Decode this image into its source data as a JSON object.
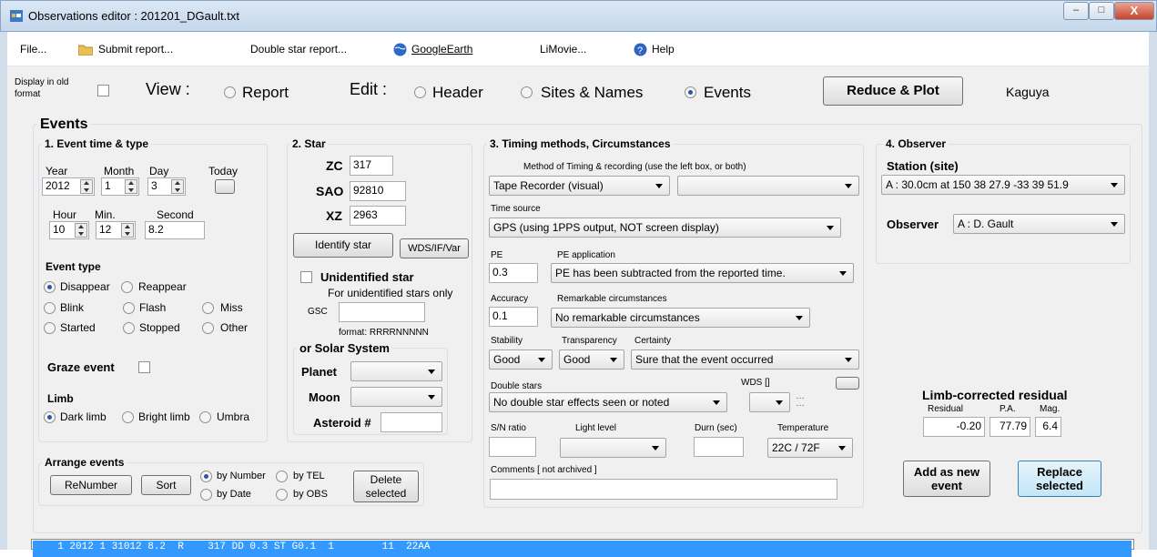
{
  "window": {
    "title": "Observations editor : 201201_DGault.txt",
    "min": "–",
    "max": "□",
    "close": "X"
  },
  "menu": {
    "file": "File...",
    "submit": "Submit report...",
    "double": "Double star report...",
    "googleearth": "GoogleEarth",
    "limovie": "LiMovie...",
    "help": "Help"
  },
  "viewbar": {
    "display_old": "Display in old format",
    "view": "View :",
    "report": "Report",
    "edit": "Edit :",
    "header": "Header",
    "sites": "Sites & Names",
    "events": "Events",
    "reduce": "Reduce & Plot",
    "target": "Kaguya"
  },
  "events_title": "Events",
  "g1": {
    "title": "1. Event time & type",
    "year": "Year",
    "month": "Month",
    "day": "Day",
    "today": "Today",
    "year_val": "2012",
    "month_val": "1",
    "day_val": "3",
    "hour": "Hour",
    "min": "Min.",
    "second": "Second",
    "hour_val": "10",
    "min_val": "12",
    "sec_val": "8.2",
    "event_type": "Event type",
    "disappear": "Disappear",
    "reappear": "Reappear",
    "blink": "Blink",
    "flash": "Flash",
    "miss": "Miss",
    "started": "Started",
    "stopped": "Stopped",
    "other": "Other",
    "graze": "Graze event",
    "limb": "Limb",
    "dark": "Dark limb",
    "bright": "Bright limb",
    "umbra": "Umbra"
  },
  "g2": {
    "title": "2. Star",
    "zc": "ZC",
    "zc_val": "317",
    "sao": "SAO",
    "sao_val": "92810",
    "xz": "XZ",
    "xz_val": "2963",
    "identify": "Identify star",
    "wds": "WDS/IF/Var",
    "unidentified": "Unidentified star",
    "unid_note": "For unidentified stars only",
    "gsc": "GSC",
    "format": "format: RRRRNNNNN",
    "solar": "or  Solar System",
    "planet": "Planet",
    "moon": "Moon",
    "asteroid": "Asteroid #"
  },
  "g3": {
    "title": "3.  Timing methods, Circumstances",
    "method_label": "Method of Timing & recording (use the left box, or both)",
    "method1": "Tape Recorder (visual)",
    "method2": "",
    "time_source": "Time source",
    "time_source_val": "GPS   (using 1PPS output, NOT screen display)",
    "pe": "PE",
    "pe_val": "0.3",
    "pe_app": "PE application",
    "pe_app_val": "PE has been subtracted from the reported time.",
    "accuracy": "Accuracy",
    "accuracy_val": "0.1",
    "remarkable": "Remarkable circumstances",
    "remarkable_val": "No remarkable circumstances",
    "stability": "Stability",
    "stability_val": "Good",
    "transparency": "Transparency",
    "transparency_val": "Good",
    "certainty": "Certainty",
    "certainty_val": "Sure that the event occurred",
    "double": "Double stars",
    "double_val": "No double star effects seen or noted",
    "wds": "WDS []",
    "sn": "S/N ratio",
    "light": "Light level",
    "durn": "Durn (sec)",
    "temp": "Temperature",
    "temp_val": "22C / 72F",
    "comments": "Comments   [ not archived ]"
  },
  "g4": {
    "title": "4.  Observer",
    "station": "Station (site)",
    "station_val": "A : 30.0cm at  150 38 27.9 -33 39 51.9",
    "observer": "Observer",
    "observer_val": "A : D. Gault"
  },
  "limb": {
    "title": "Limb-corrected residual",
    "residual": "Residual",
    "pa": "P.A.",
    "mag": "Mag.",
    "residual_val": "-0.20",
    "pa_val": "77.79",
    "mag_val": "6.4"
  },
  "actions": {
    "add": "Add as new event",
    "replace": "Replace selected"
  },
  "arrange": {
    "title": "Arrange events",
    "renumber": "ReNumber",
    "sort": "Sort",
    "by_number": "by Number",
    "by_tel": "by TEL",
    "by_date": "by Date",
    "by_obs": "by OBS",
    "delete": "Delete selected"
  },
  "event_list": [
    "  1 2012 1 31012 8.2  R    317 DD 0.3 ST G0.1  1        11  22AA"
  ]
}
